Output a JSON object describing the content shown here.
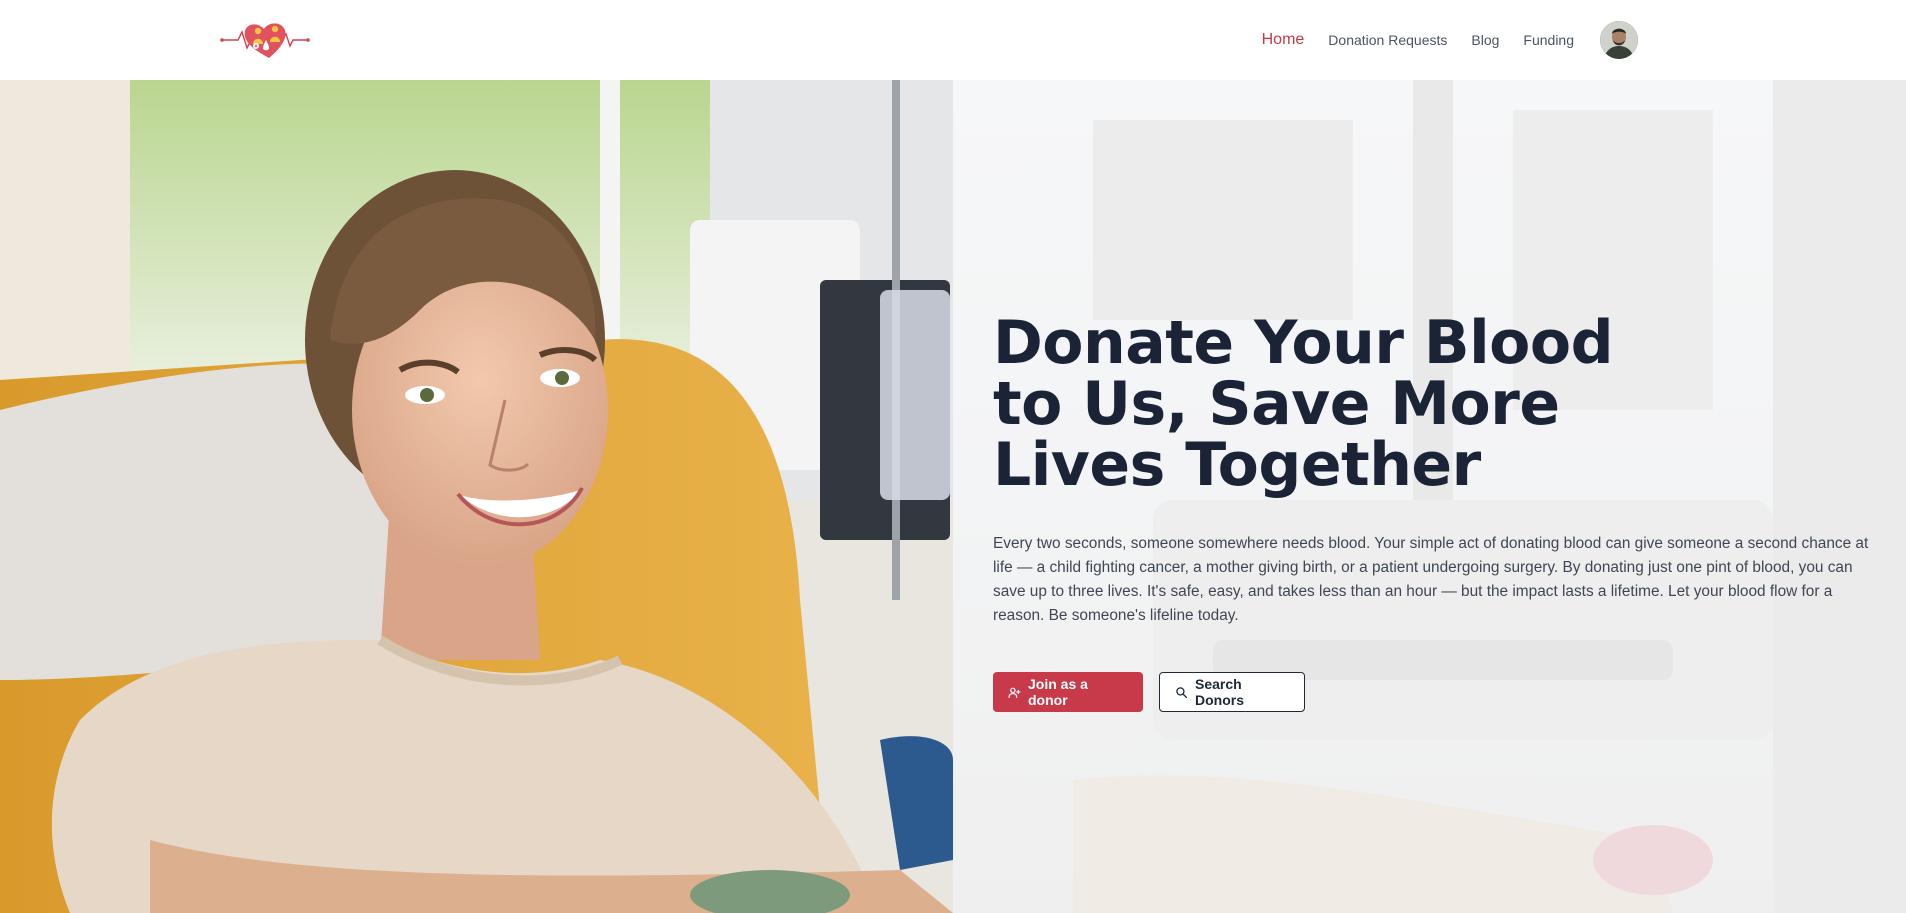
{
  "brand": {
    "accent": "#c8394a",
    "logo_icon": "heart-pulse-drop-logo"
  },
  "nav": {
    "items": [
      {
        "label": "Home",
        "active": true
      },
      {
        "label": "Donation Requests",
        "active": false
      },
      {
        "label": "Blog",
        "active": false
      },
      {
        "label": "Funding",
        "active": false
      }
    ],
    "avatar_icon": "user-avatar"
  },
  "hero": {
    "title": "Donate Your Blood to Us, Save More Lives Together",
    "description": "Every two seconds, someone somewhere needs blood. Your simple act of donating blood can give someone a second chance at life — a child fighting cancer, a mother giving birth, or a patient undergoing surgery. By donating just one pint of blood, you can save up to three lives. It's safe, easy, and takes less than an hour — but the impact lasts a lifetime. Let your blood flow for a reason. Be someone's lifeline today.",
    "primary_button": {
      "label": "Join as a donor",
      "icon": "user-plus-icon"
    },
    "secondary_button": {
      "label": "Search Donors",
      "icon": "search-icon"
    },
    "photo_icon": "smiling-donor-photo"
  }
}
